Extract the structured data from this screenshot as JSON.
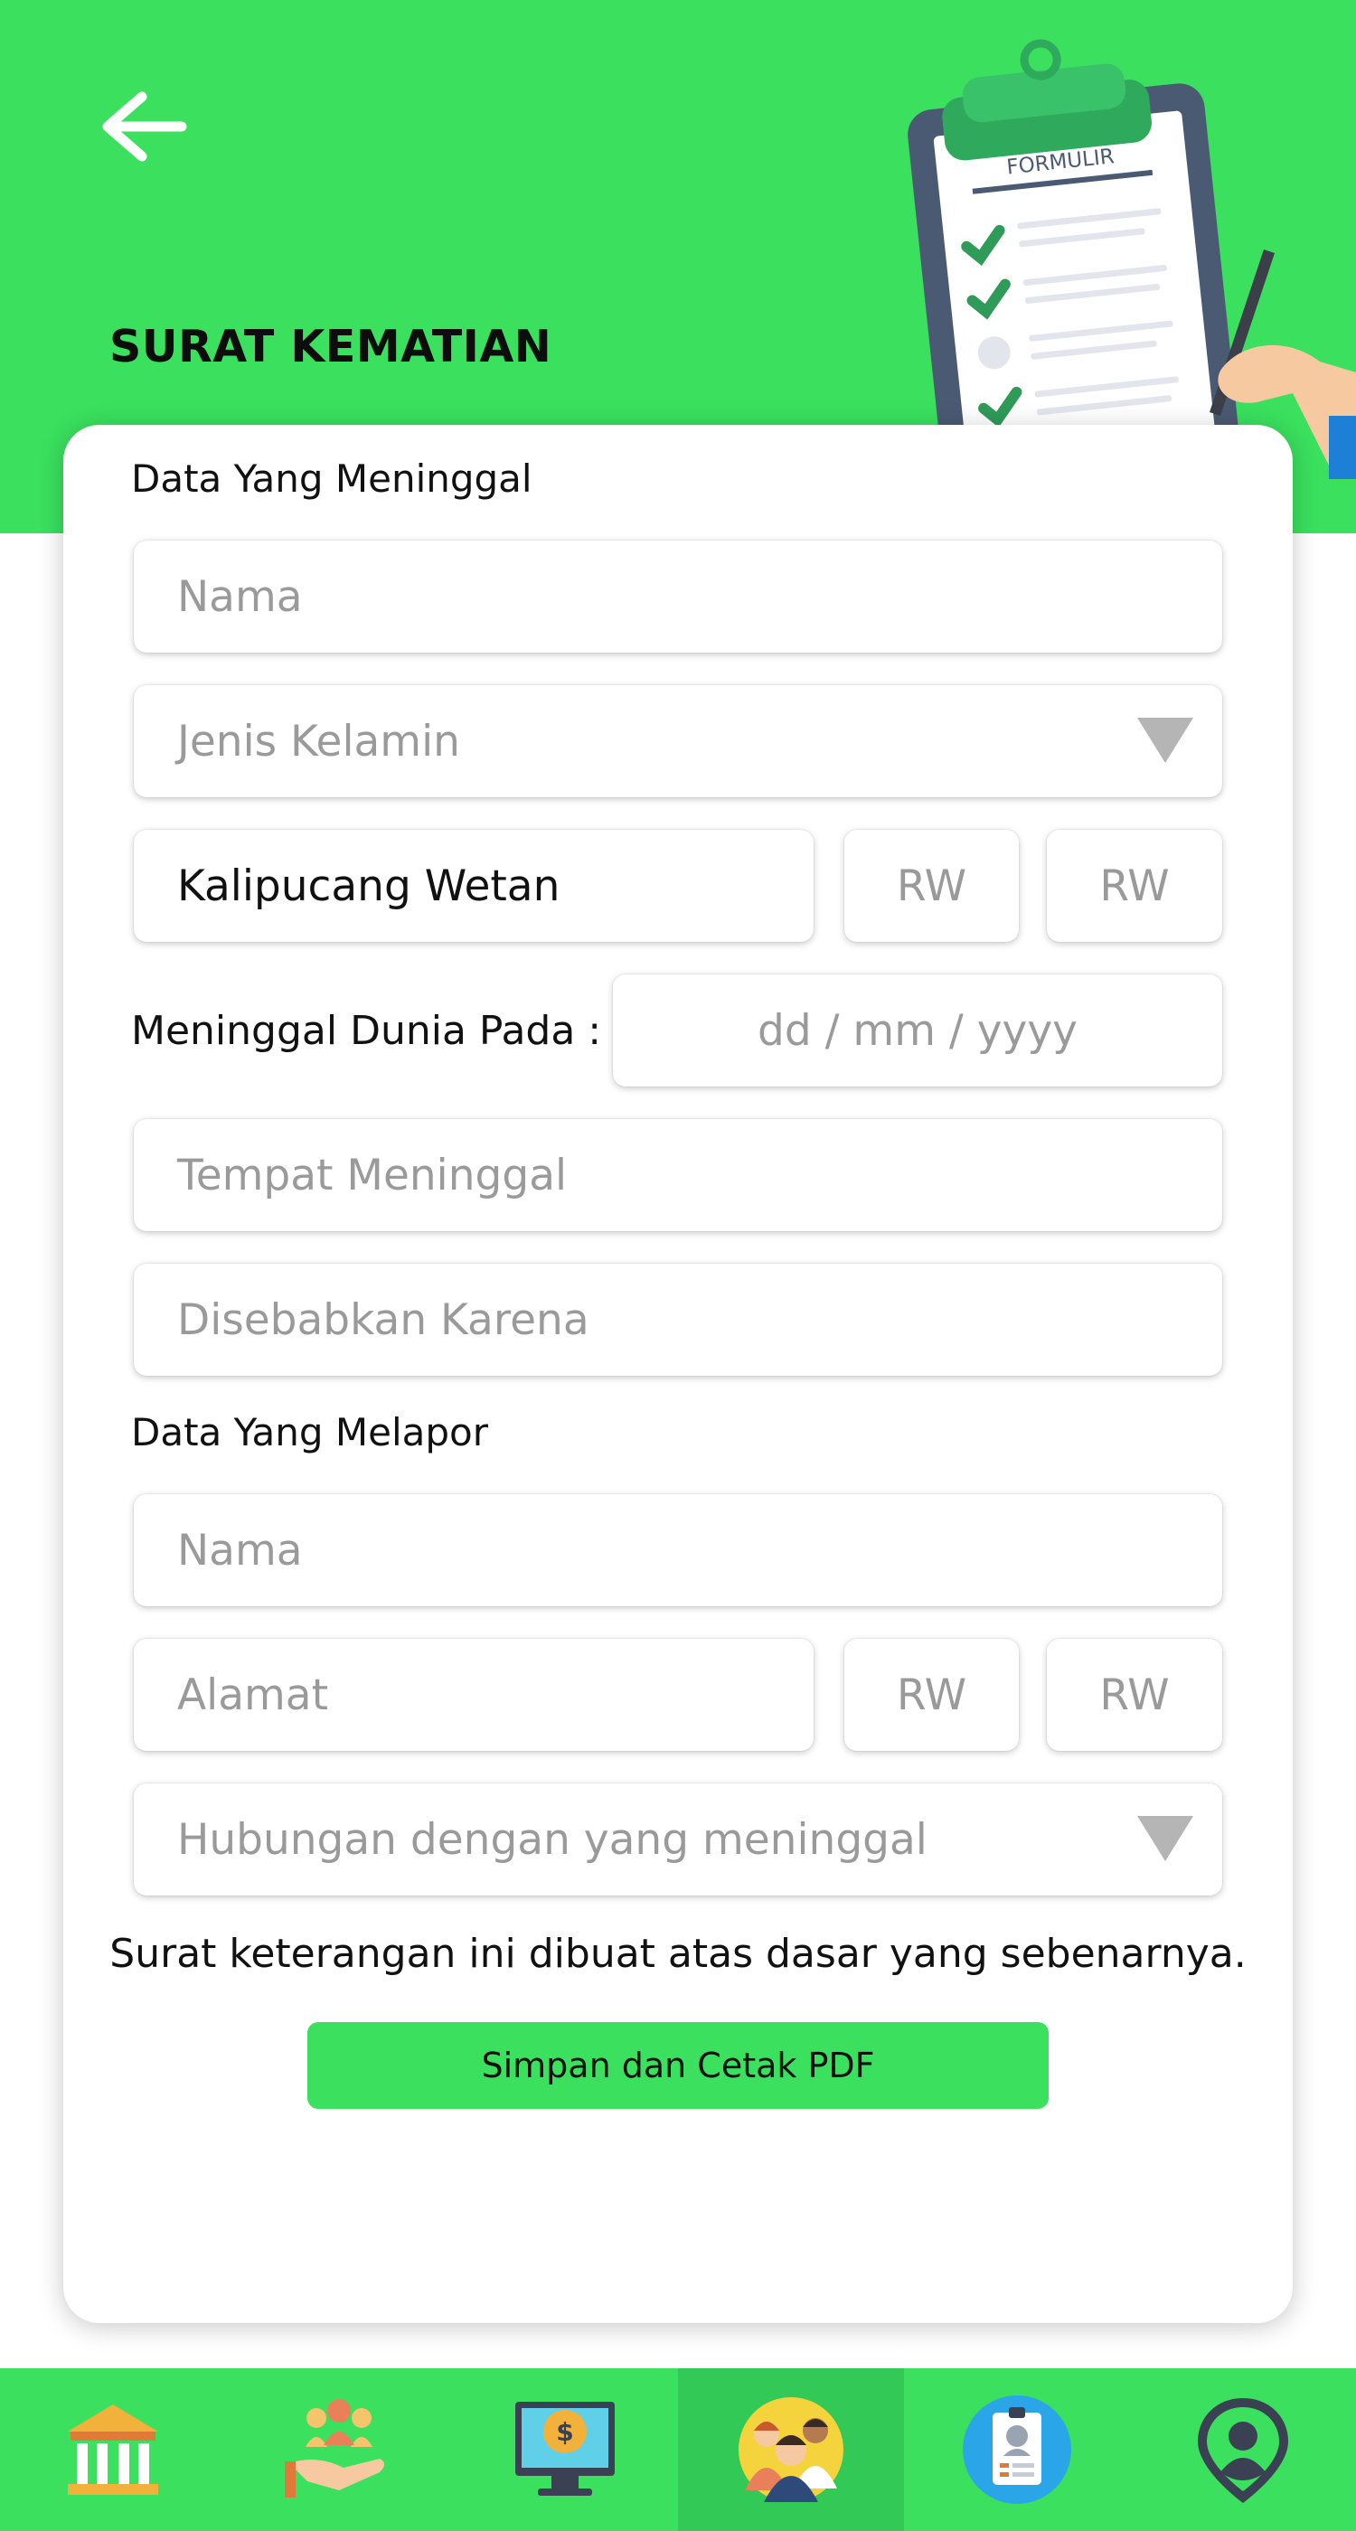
{
  "header": {
    "title": "SURAT KEMATIAN",
    "illustration_label": "FORMULIR",
    "background_color": "#3ae05e",
    "back_icon": "arrow-left-icon"
  },
  "form": {
    "deceased": {
      "section_label": "Data Yang Meninggal",
      "name_placeholder": "Nama",
      "gender_placeholder": "Jenis Kelamin",
      "address_value": "Kalipucang Wetan",
      "rw1_placeholder": "RW",
      "rw2_placeholder": "RW",
      "date_label": "Meninggal Dunia Pada :",
      "date_placeholder": "dd / mm / yyyy",
      "place_placeholder": "Tempat Meninggal",
      "cause_placeholder": "Disebabkan Karena"
    },
    "reporter": {
      "section_label": "Data Yang Melapor",
      "name_placeholder": "Nama",
      "address_placeholder": "Alamat",
      "rw1_placeholder": "RW",
      "rw2_placeholder": "RW",
      "relation_placeholder": "Hubungan dengan yang meninggal"
    },
    "statement": "Surat keterangan ini dibuat atas dasar yang sebenarnya.",
    "submit_label": "Simpan dan Cetak PDF"
  },
  "bottom_nav": {
    "items": [
      {
        "icon": "government-building-icon",
        "active": false
      },
      {
        "icon": "community-hand-icon",
        "active": false
      },
      {
        "icon": "finance-monitor-icon",
        "active": false
      },
      {
        "icon": "people-group-icon",
        "active": true
      },
      {
        "icon": "id-card-icon",
        "active": false
      },
      {
        "icon": "user-location-icon",
        "active": false
      }
    ]
  }
}
